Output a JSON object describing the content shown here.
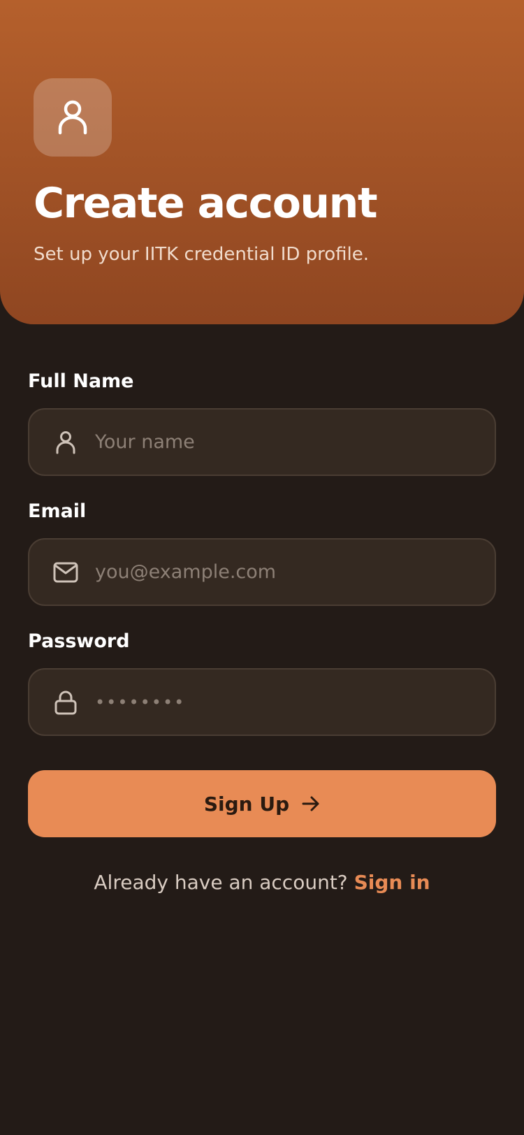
{
  "header": {
    "title": "Create account",
    "subtitle": "Set up your IITK credential ID profile."
  },
  "form": {
    "full_name": {
      "label": "Full Name",
      "placeholder": "Your name",
      "icon": "user-icon"
    },
    "email": {
      "label": "Email",
      "placeholder": "you@example.com",
      "icon": "mail-icon"
    },
    "password": {
      "label": "Password",
      "placeholder": "••••••••",
      "icon": "lock-icon"
    },
    "submit_label": "Sign Up"
  },
  "footer": {
    "prompt": "Already have an account?",
    "link": "Sign in"
  },
  "colors": {
    "accent": "#e88b55",
    "background": "#231b17",
    "header_top": "#b5602c",
    "header_bottom": "#8f4621"
  }
}
